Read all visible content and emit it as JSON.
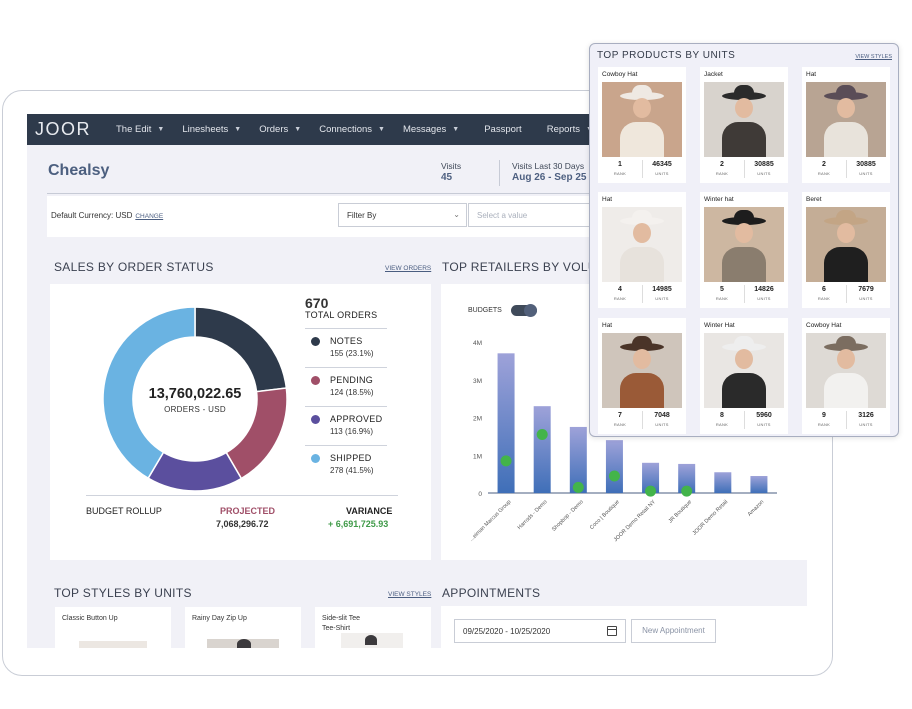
{
  "nav": {
    "logo": "JOOR",
    "items": [
      {
        "label": "The Edit",
        "caret": true
      },
      {
        "label": "Linesheets",
        "caret": true
      },
      {
        "label": "Orders",
        "caret": true
      },
      {
        "label": "Connections",
        "caret": true
      },
      {
        "label": "Messages",
        "caret": true
      },
      {
        "label": "Passport",
        "caret": false
      },
      {
        "label": "Reports",
        "caret": true
      }
    ]
  },
  "header": {
    "title": "Chealsy",
    "visits_label": "Visits",
    "visits_value": "45",
    "visits30_label": "Visits Last 30 Days",
    "visits30_value": "Aug 26 - Sep 25"
  },
  "filters": {
    "currency_label": "Default Currency: USD",
    "change_link": "CHANGE",
    "filter_by": "Filter By",
    "select_placeholder": "Select a value"
  },
  "sales": {
    "title": "SALES BY ORDER STATUS",
    "view_link": "VIEW ORDERS",
    "total_value": "13,760,022.65",
    "total_caption": "ORDERS - USD",
    "total_orders_value": "670",
    "total_orders_label": "TOTAL ORDERS",
    "statuses": [
      {
        "label": "NOTES",
        "detail": "155 (23.1%)",
        "share": 23.1,
        "color": "#2e3a4b"
      },
      {
        "label": "PENDING",
        "detail": "124 (18.5%)",
        "share": 18.5,
        "color": "#a04f68"
      },
      {
        "label": "APPROVED",
        "detail": "113 (16.9%)",
        "share": 16.9,
        "color": "#5b4f9e"
      },
      {
        "label": "SHIPPED",
        "detail": "278 (41.5%)",
        "share": 41.5,
        "color": "#6ab3e2"
      }
    ],
    "budget_label": "BUDGET ROLLUP",
    "projected_label": "PROJECTED",
    "projected_value": "7,068,296.72",
    "variance_label": "VARIANCE",
    "variance_value": "+ 6,691,725.93"
  },
  "retailers": {
    "title": "TOP RETAILERS BY VOLU",
    "budgets_label": "BUDGETS",
    "chart_data": {
      "type": "bar",
      "categories": [
        "...eiman Marcus Group",
        "Harrods - Demo",
        "Shopbop - Demo",
        "Coco | Boutique",
        "JOOR Demo Retail NY",
        "JR Boutique",
        "JOOR Demo Retail",
        "Amazon"
      ],
      "series": [
        {
          "values": [
            3.7,
            2.3,
            1.75,
            1.4,
            0.8,
            0.77,
            0.55,
            0.45
          ]
        },
        {
          "values": [
            0.85,
            1.55,
            0.15,
            0.45,
            0.05,
            0.05,
            null,
            null
          ]
        }
      ],
      "yticks": [
        "0",
        "1M",
        "2M",
        "3M",
        "4M"
      ],
      "ylim": [
        0,
        4
      ]
    }
  },
  "styles": {
    "title": "TOP STYLES BY UNITS",
    "view_link": "VIEW STYLES",
    "items": [
      {
        "name": "Classic Button Up"
      },
      {
        "name": "Rainy Day Zip Up"
      },
      {
        "name": "Side-slit Tee\nTee-Shirt"
      }
    ]
  },
  "appointments": {
    "title": "APPOINTMENTS",
    "date_range": "09/25/2020 - 10/25/2020",
    "new_button": "New Appointment"
  },
  "top_products": {
    "title": "TOP PRODUCTS BY UNITS",
    "view_link": "VIEW STYLES",
    "rank_label": "RANK",
    "units_label": "UNITS",
    "items": [
      {
        "name": "Cowboy Hat",
        "rank": "1",
        "units": "46345"
      },
      {
        "name": "Jacket",
        "rank": "2",
        "units": "30885"
      },
      {
        "name": "Hat",
        "rank": "2",
        "units": "30885"
      },
      {
        "name": "Hat",
        "rank": "4",
        "units": "14985"
      },
      {
        "name": "Winter hat",
        "rank": "5",
        "units": "14826"
      },
      {
        "name": "Beret",
        "rank": "6",
        "units": "7679"
      },
      {
        "name": "Hat",
        "rank": "7",
        "units": "7048"
      },
      {
        "name": "Winter Hat",
        "rank": "8",
        "units": "5960"
      },
      {
        "name": "Cowboy Hat",
        "rank": "9",
        "units": "3126"
      }
    ]
  }
}
